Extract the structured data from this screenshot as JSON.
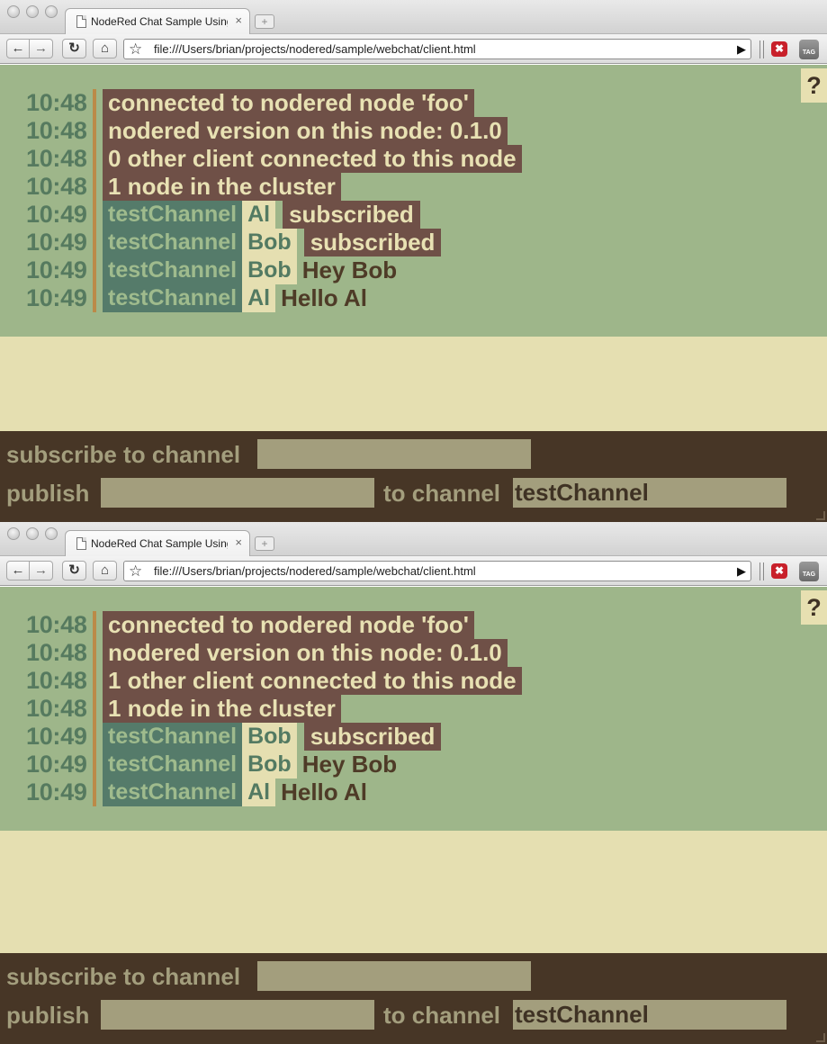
{
  "windows": [
    {
      "tab_title": "NodeRed Chat Sample Using",
      "tab_close": "×",
      "new_tab": "+",
      "url": "file:///Users/brian/projects/nodered/sample/webchat/client.html",
      "help": "?",
      "log": [
        {
          "time": "10:48",
          "text": "connected to nodered node 'foo'"
        },
        {
          "time": "10:48",
          "text": "nodered version on this node: 0.1.0"
        },
        {
          "time": "10:48",
          "text": "0 other client connected to this node"
        },
        {
          "time": "10:48",
          "text": "1 node in the cluster"
        },
        {
          "time": "10:49",
          "channel": "testChannel",
          "user": "Al",
          "event": "subscribed"
        },
        {
          "time": "10:49",
          "channel": "testChannel",
          "user": "Bob",
          "event": "subscribed"
        },
        {
          "time": "10:49",
          "channel": "testChannel",
          "user": "Bob",
          "message": "Hey Bob"
        },
        {
          "time": "10:49",
          "channel": "testChannel",
          "user": "Al",
          "message": "Hello Al"
        }
      ],
      "form": {
        "subscribe_label": "subscribe to channel",
        "subscribe_value": "",
        "publish_label": "publish",
        "publish_value": "",
        "to_channel_label": "to channel",
        "channel_value": "testChannel"
      }
    },
    {
      "tab_title": "NodeRed Chat Sample Using",
      "tab_close": "×",
      "new_tab": "+",
      "url": "file:///Users/brian/projects/nodered/sample/webchat/client.html",
      "help": "?",
      "log": [
        {
          "time": "10:48",
          "text": "connected to nodered node 'foo'"
        },
        {
          "time": "10:48",
          "text": "nodered version on this node: 0.1.0"
        },
        {
          "time": "10:48",
          "text": "1 other client connected to this node"
        },
        {
          "time": "10:48",
          "text": "1 node in the cluster"
        },
        {
          "time": "10:49",
          "channel": "testChannel",
          "user": "Bob",
          "event": "subscribed"
        },
        {
          "time": "10:49",
          "channel": "testChannel",
          "user": "Bob",
          "message": "Hey Bob"
        },
        {
          "time": "10:49",
          "channel": "testChannel",
          "user": "Al",
          "message": "Hello Al"
        }
      ],
      "form": {
        "subscribe_label": "subscribe to channel",
        "subscribe_value": "",
        "publish_label": "publish",
        "publish_value": "",
        "to_channel_label": "to channel",
        "channel_value": "testChannel"
      }
    }
  ],
  "toolbar_icons": {
    "back": "←",
    "forward": "→",
    "reload": "↻",
    "home": "⌂",
    "star": "☆",
    "go": "▶",
    "extension": "✖",
    "tag": "TAG"
  },
  "colors": {
    "log_background": "#9eb68a",
    "system_message_bg": "#6f5047",
    "channel_bg": "#557b6a",
    "user_bg": "#e5dfb1",
    "timestamp": "#567a5f",
    "bottom_panel": "#473626",
    "input_bg": "#a39e7d"
  }
}
